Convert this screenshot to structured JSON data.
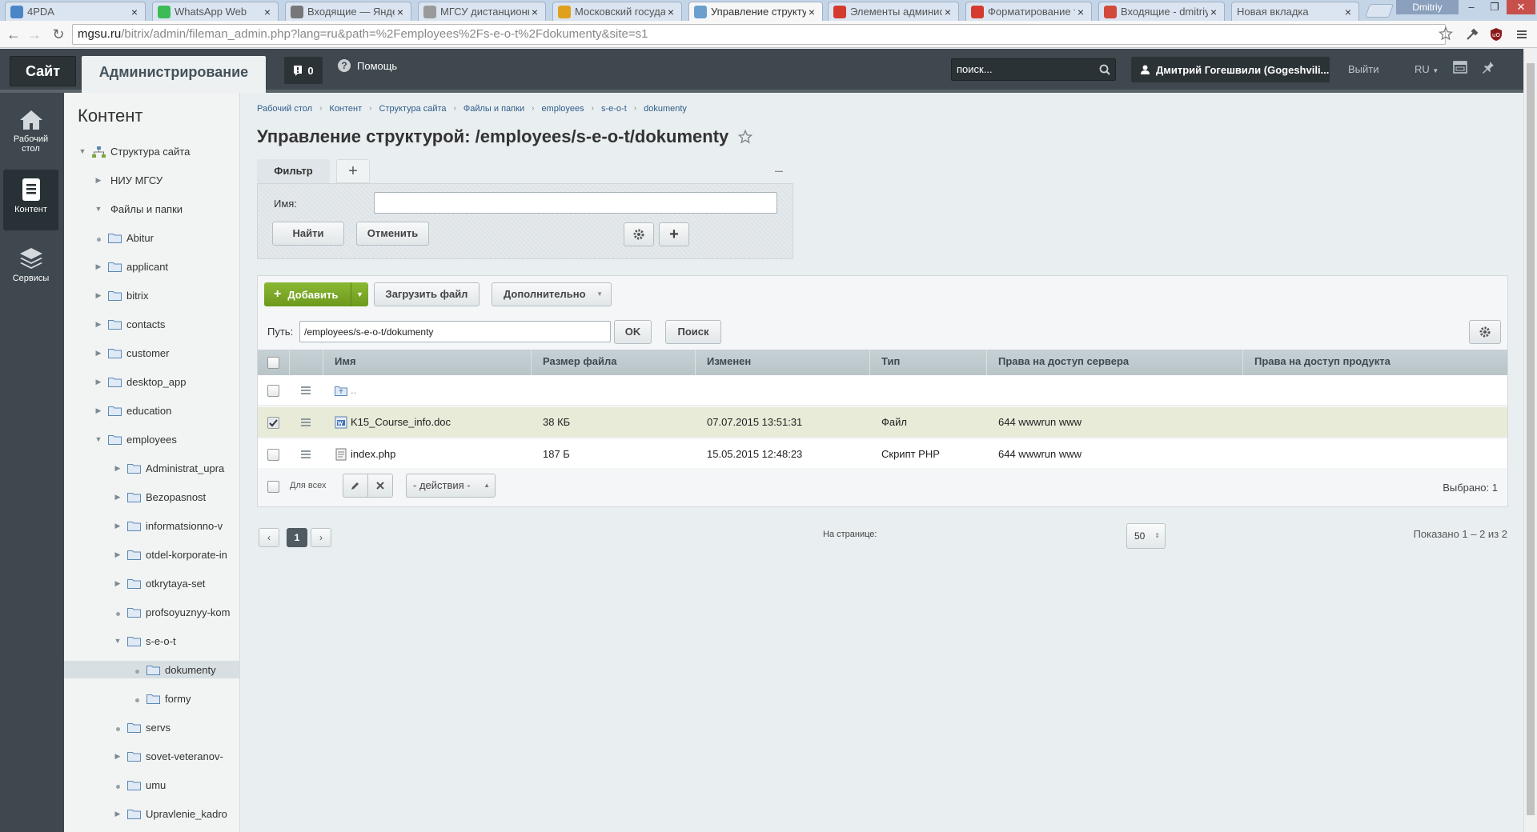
{
  "browser": {
    "tabs": [
      {
        "title": "4PDA",
        "color": "#4a86c5"
      },
      {
        "title": "WhatsApp Web",
        "color": "#3cbb57"
      },
      {
        "title": "Входящие — Яндекс",
        "color": "#777777"
      },
      {
        "title": "МГСУ дистанционно",
        "color": "#9a9a9a"
      },
      {
        "title": "Московский государ",
        "color": "#e0a01c"
      },
      {
        "title": "Управление структур",
        "color": "#6a9fd0"
      },
      {
        "title": "Элементы администр",
        "color": "#d43b30"
      },
      {
        "title": "Форматирование те",
        "color": "#d43b30"
      },
      {
        "title": "Входящие - dmitriy.g",
        "color": "#d24a3b"
      },
      {
        "title": "Новая вкладка",
        "color": ""
      }
    ],
    "tab_close": "×",
    "window_user": "Dmitriy",
    "window_buttons": {
      "minimize": "‒",
      "restore": "❐",
      "close": "✕"
    },
    "url_host": "mgsu.ru",
    "url_path": "/bitrix/admin/fileman_admin.php?lang=ru&path=%2Femployees%2Fs-e-o-t%2Fdokumenty&site=s1"
  },
  "header": {
    "site_label": "Сайт",
    "admin_label": "Администрирование",
    "notifications_count": "0",
    "help_label": "Помощь",
    "search_placeholder": "поиск...",
    "user_name": "Дмитрий Гогешвили (Gogeshvili...",
    "exit_label": "Выйти",
    "lang_label": "RU"
  },
  "left_menu": [
    {
      "label": "Рабочий стол",
      "icon": "home-icon",
      "active": false
    },
    {
      "label": "Контент",
      "icon": "document-icon",
      "active": true
    },
    {
      "label": "Сервисы",
      "icon": "layers-icon",
      "active": false
    }
  ],
  "tree": {
    "title": "Контент",
    "items": [
      {
        "label": "Структура сайта",
        "level": 0,
        "state": "open",
        "icon": "sitemap"
      },
      {
        "label": "НИУ МГСУ",
        "level": 1,
        "state": "closed",
        "icon": "none"
      },
      {
        "label": "Файлы и папки",
        "level": 1,
        "state": "open",
        "icon": "none"
      },
      {
        "label": "Abitur",
        "level": 2,
        "state": "leaf",
        "icon": "folder"
      },
      {
        "label": "applicant",
        "level": 2,
        "state": "closed",
        "icon": "folder"
      },
      {
        "label": "bitrix",
        "level": 2,
        "state": "closed",
        "icon": "folder"
      },
      {
        "label": "contacts",
        "level": 2,
        "state": "closed",
        "icon": "folder"
      },
      {
        "label": "customer",
        "level": 2,
        "state": "closed",
        "icon": "folder"
      },
      {
        "label": "desktop_app",
        "level": 2,
        "state": "closed",
        "icon": "folder"
      },
      {
        "label": "education",
        "level": 2,
        "state": "closed",
        "icon": "folder"
      },
      {
        "label": "employees",
        "level": 2,
        "state": "open",
        "icon": "folder"
      },
      {
        "label": "Administrat_upra",
        "level": 3,
        "state": "closed",
        "icon": "folder"
      },
      {
        "label": "Bezopasnost",
        "level": 3,
        "state": "closed",
        "icon": "folder"
      },
      {
        "label": "informatsionno-v",
        "level": 3,
        "state": "closed",
        "icon": "folder"
      },
      {
        "label": "otdel-korporate-in",
        "level": 3,
        "state": "closed",
        "icon": "folder"
      },
      {
        "label": "otkrytaya-set",
        "level": 3,
        "state": "closed",
        "icon": "folder"
      },
      {
        "label": "profsoyuznyy-kom",
        "level": 3,
        "state": "leaf",
        "icon": "folder"
      },
      {
        "label": "s-e-o-t",
        "level": 3,
        "state": "open",
        "icon": "folder"
      },
      {
        "label": "dokumenty",
        "level": 4,
        "state": "leaf",
        "icon": "folder",
        "selected": true
      },
      {
        "label": "formy",
        "level": 4,
        "state": "leaf",
        "icon": "folder"
      },
      {
        "label": "servs",
        "level": 3,
        "state": "leaf",
        "icon": "folder"
      },
      {
        "label": "sovet-veteranov-",
        "level": 3,
        "state": "closed",
        "icon": "folder"
      },
      {
        "label": "umu",
        "level": 3,
        "state": "leaf",
        "icon": "folder"
      },
      {
        "label": "Upravlenie_kadro",
        "level": 3,
        "state": "closed",
        "icon": "folder"
      }
    ]
  },
  "breadcrumb": [
    "Рабочий стол",
    "Контент",
    "Структура сайта",
    "Файлы и папки",
    "employees",
    "s-e-o-t",
    "dokumenty"
  ],
  "page_title": "Управление структурой: /employees/s-e-o-t/dokumenty",
  "filter": {
    "tab_label": "Фильтр",
    "name_label": "Имя:",
    "name_value": "",
    "find_label": "Найти",
    "cancel_label": "Отменить"
  },
  "toolbar": {
    "add_label": "Добавить",
    "upload_label": "Загрузить файл",
    "more_label": "Дополнительно",
    "path_label": "Путь:",
    "path_value": "/employees/s-e-o-t/dokumenty",
    "ok_label": "OK",
    "search_label": "Поиск"
  },
  "table": {
    "columns": [
      "Имя",
      "Размер файла",
      "Изменен",
      "Тип",
      "Права на доступ сервера",
      "Права на доступ продукта"
    ],
    "rows": [
      {
        "name": "..",
        "size": "",
        "modified": "",
        "type": "",
        "server_rights": "",
        "product_rights": "",
        "icon": "folder-up-icon",
        "checked": false
      },
      {
        "name": "K15_Course_info.doc",
        "size": "38 КБ",
        "modified": "07.07.2015 13:51:31",
        "type": "Файл",
        "server_rights": "644 wwwrun www",
        "product_rights": "",
        "icon": "doc-file-icon",
        "checked": true
      },
      {
        "name": "index.php",
        "size": "187 Б",
        "modified": "15.05.2015 12:48:23",
        "type": "Скрипт PHP",
        "server_rights": "644 wwwrun www",
        "product_rights": "",
        "icon": "php-file-icon",
        "checked": false
      }
    ],
    "for_all_label": "Для всех",
    "actions_label": "- действия -",
    "selected_label": "Выбрано: 1"
  },
  "pagination": {
    "current_page": "1",
    "per_page_label": "На странице:",
    "per_page_value": "50",
    "shown_label": "Показано 1 – 2 из 2"
  }
}
